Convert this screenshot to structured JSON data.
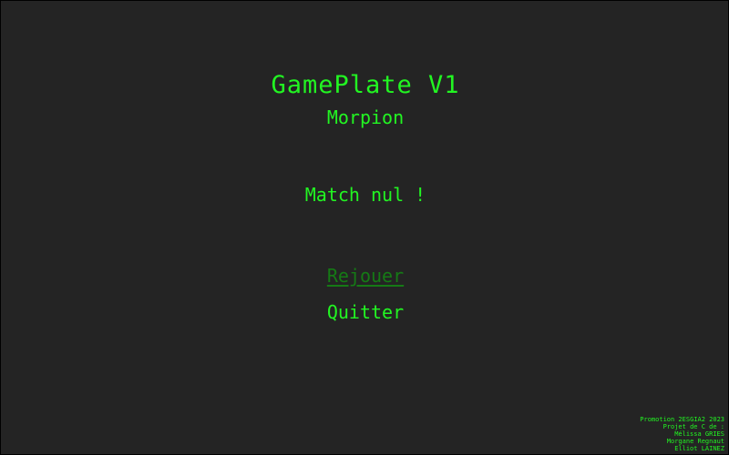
{
  "game": {
    "title": "GamePlate V1",
    "subtitle": "Morpion",
    "result": "Match nul !"
  },
  "menu": {
    "replay_label": "Rejouer",
    "quit_label": "Quitter",
    "selected": "Rejouer"
  },
  "credits": {
    "lines": [
      "Promotion 2ESGIA2 2023",
      "Projet de C de :",
      "Mélissa GRIES",
      "Morgane Regnaut",
      "Elliot LAINEZ"
    ]
  },
  "colors": {
    "background": "#242424",
    "text": "#22f522",
    "selected_option": "#157a15"
  }
}
